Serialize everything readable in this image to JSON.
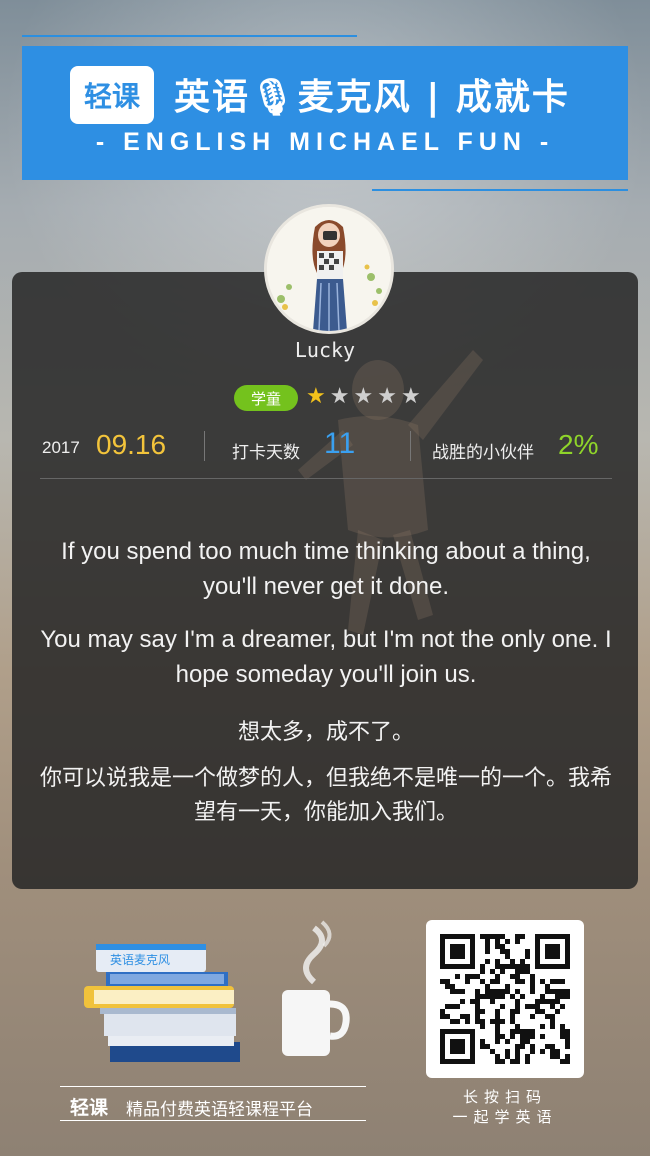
{
  "header": {
    "logo": "轻课",
    "title": "英语🎙麦克风 | 成就卡",
    "subtitle": "- ENGLISH  MICHAEL  FUN -"
  },
  "profile": {
    "avatar_icon": "girl-with-camera-avatar",
    "username": "Lucky",
    "level_badge": "学童",
    "stars_total": 5,
    "stars_filled": 1,
    "star_on_color": "#f3c21b",
    "star_off_color": "#cfcfcf"
  },
  "stats": {
    "year": "2017",
    "month_day": "09.16",
    "checkin_label": "打卡天数",
    "checkin_value": "11",
    "beat_label": "战胜的小伙伴",
    "beat_value": "2%"
  },
  "quotes": {
    "en1": "If you spend too much time thinking about a thing, you'll never get it done.",
    "en2": "You may say I'm a dreamer, but I'm not the only one. I hope someday you'll join us.",
    "zh1": "想太多，成不了。",
    "zh2": "你可以说我是一个做梦的人，但我绝不是唯一的一个。我希望有一天，你能加入我们。"
  },
  "footer": {
    "book_label": "英语麦克风",
    "slogan_logo": "轻课",
    "slogan": "精品付费英语轻课程平台",
    "qr_caption_1": "长按扫码",
    "qr_caption_2": "一起学英语"
  },
  "colors": {
    "brand_blue": "#2e8fe3",
    "date_yellow": "#f3c43b",
    "checkin_blue": "#3aa0f0",
    "beat_green": "#8fd42a",
    "badge_green": "#74c21d"
  }
}
